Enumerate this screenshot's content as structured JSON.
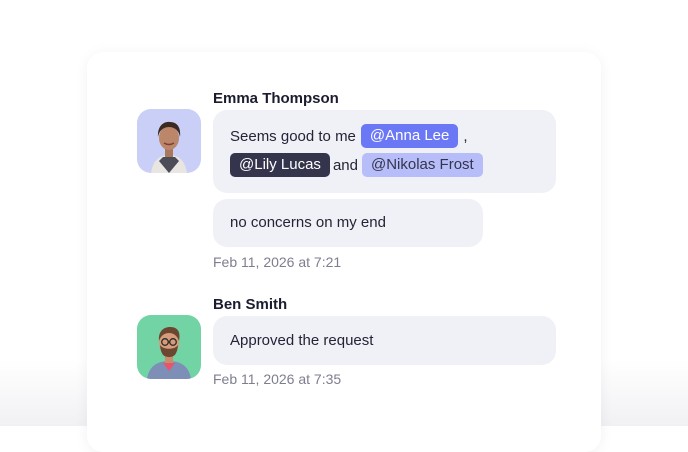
{
  "messages": [
    {
      "author": "Emma Thompson",
      "bubble1": {
        "text_before": "Seems good to me",
        "mention_1": "@Anna Lee",
        "comma": ",",
        "mention_2": "@Lily Lucas",
        "and_word": "and",
        "mention_3": "@Nikolas Frost"
      },
      "bubble2": "no concerns on my end",
      "timestamp": "Feb 11, 2026 at 7:21"
    },
    {
      "author": "Ben Smith",
      "bubble1": "Approved the request",
      "timestamp": "Feb 11, 2026 at 7:35"
    }
  ],
  "colors": {
    "mention_primary": "#6b78f6",
    "mention_dark": "#34354d",
    "mention_light": "#b7bdf8",
    "bubble_bg": "#f0f1f6",
    "avatar_emma_bg": "#c9cff7",
    "avatar_ben_bg": "#72d3a4"
  }
}
